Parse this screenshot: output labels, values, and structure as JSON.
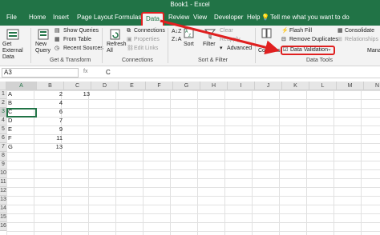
{
  "window": {
    "title": "Book1 - Excel"
  },
  "tabs": [
    {
      "label": "File"
    },
    {
      "label": "Home"
    },
    {
      "label": "Insert"
    },
    {
      "label": "Page Layout"
    },
    {
      "label": "Formulas"
    },
    {
      "label": "Data"
    },
    {
      "label": "Review"
    },
    {
      "label": "View"
    },
    {
      "label": "Developer"
    },
    {
      "label": "Help"
    }
  ],
  "tell_me": "Tell me what you want to do",
  "ribbon": {
    "get_external": "Get External Data",
    "new_query": "New Query",
    "show_queries": "Show Queries",
    "from_table": "From Table",
    "recent_sources": "Recent Sources",
    "get_transform": "Get & Transform",
    "refresh_all": "Refresh All",
    "connections": "Connections",
    "properties": "Properties",
    "edit_links": "Edit Links",
    "connections_group": "Connections",
    "sort": "Sort",
    "filter": "Filter",
    "clear": "Clear",
    "reapply": "Reapply",
    "advanced": "Advanced",
    "sort_filter": "Sort & Filter",
    "text_to_columns": "Columns",
    "flash_fill": "Flash Fill",
    "remove_duplicates": "Remove Duplicates",
    "data_validation": "Data Validation",
    "consolidate": "Consolidate",
    "relationships": "Relationships",
    "manage": "Mana",
    "data_tools": "Data Tools"
  },
  "formula_bar": {
    "name_box": "A3",
    "fx": "fx",
    "value": "C"
  },
  "columns": [
    "A",
    "B",
    "C",
    "D",
    "E",
    "F",
    "G",
    "H",
    "I",
    "J",
    "K",
    "L",
    "M",
    "N"
  ],
  "rows": [
    "1",
    "2",
    "3",
    "4",
    "5",
    "6",
    "7",
    "8",
    "9",
    "10",
    "11",
    "12",
    "13",
    "14",
    "15",
    "16"
  ],
  "cells": {
    "A1": "A",
    "A2": "B",
    "A3": "C",
    "A4": "D",
    "A5": "E",
    "A6": "F",
    "A7": "G",
    "B1": "2",
    "B2": "4",
    "B3": "6",
    "B4": "7",
    "B5": "9",
    "B6": "11",
    "B7": "13",
    "C1": "13"
  },
  "colors": {
    "excel_green": "#217346",
    "highlight_red": "#e02020"
  }
}
